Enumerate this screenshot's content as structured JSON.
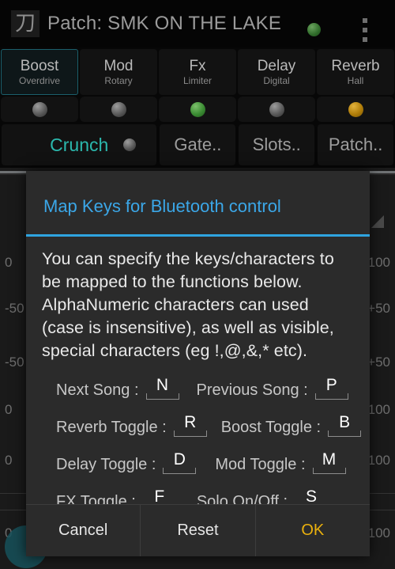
{
  "titlebar": {
    "app_icon_glyph": "刀",
    "title": "Patch: SMK ON THE LAKE",
    "status_led_color": "#3b8c33",
    "overflow_icon": "kebab-menu-icon"
  },
  "slots": [
    {
      "name": "Boost",
      "sub": "Overdrive",
      "active": true
    },
    {
      "name": "Mod",
      "sub": "Rotary",
      "active": false
    },
    {
      "name": "Fx",
      "sub": "Limiter",
      "active": false
    },
    {
      "name": "Delay",
      "sub": "Digital",
      "active": false
    },
    {
      "name": "Reverb",
      "sub": "Hall",
      "active": false
    }
  ],
  "leds": [
    "gray",
    "gray",
    "green",
    "gray",
    "amber"
  ],
  "controls": [
    {
      "label": "Crunch",
      "accent": true,
      "has_led": true
    },
    {
      "label": "Gate..",
      "accent": false,
      "has_led": false
    },
    {
      "label": "Slots..",
      "accent": false,
      "has_led": false
    },
    {
      "label": "Patch..",
      "accent": false,
      "has_led": false
    }
  ],
  "background_scale": {
    "left": [
      "0",
      "-50",
      "-50",
      "0",
      "0",
      "0"
    ],
    "right": [
      "100",
      "+50",
      "+50",
      "100",
      "100",
      "100"
    ]
  },
  "dialog": {
    "title": "Map Keys for Bluetooth control",
    "message": "You can specify the keys/characters to be mapped to the functions below. AlphaNumeric characters can used (case is insensitive), as well as visible, special characters (eg !,@,&,* etc).",
    "mappings": [
      [
        {
          "label": "Next Song :",
          "value": "N"
        },
        {
          "label": "Previous Song :",
          "value": "P"
        }
      ],
      [
        {
          "label": "Reverb Toggle :",
          "value": "R"
        },
        {
          "label": "Boost Toggle :",
          "value": "B"
        }
      ],
      [
        {
          "label": "Delay Toggle :",
          "value": "D"
        },
        {
          "label": "Mod Toggle :",
          "value": "M"
        }
      ],
      [
        {
          "label": "FX Toggle :",
          "value": "F"
        },
        {
          "label": "Solo On/Off :",
          "value": "S"
        }
      ]
    ],
    "buttons": {
      "cancel": "Cancel",
      "reset": "Reset",
      "ok": "OK"
    },
    "accent_color": "#2fa4e0",
    "ok_color": "#ebb10d"
  }
}
